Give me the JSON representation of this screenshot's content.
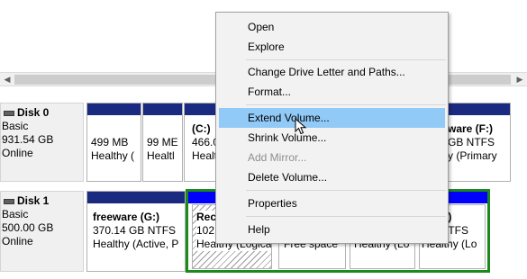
{
  "scrollbar": {
    "left_arrow": "◀",
    "right_arrow": "▶"
  },
  "disks": [
    {
      "name": "Disk 0",
      "type": "Basic",
      "size": "931.54 GB",
      "status": "Online",
      "partitions": [
        {
          "line1": "499 MB",
          "line2": "Healthy ("
        },
        {
          "line1": "99 ME",
          "line2": "Healtl"
        },
        {
          "title": "(C:)",
          "line1": "466.0",
          "line2": "Health"
        },
        {
          "title": "ware  (F:)",
          "line1": "GB NTFS",
          "line2": "y (Primary"
        }
      ]
    },
    {
      "name": "Disk 1",
      "type": "Basic",
      "size": "500.00 GB",
      "status": "Online",
      "partitions": [
        {
          "title": "freeware  (G:)",
          "line1": "370.14 GB NTFS",
          "line2": "Healthy (Active, P"
        },
        {
          "title": "Rec",
          "line1": "102.",
          "line2": "Healthy (Logica"
        },
        {
          "line2": "Free space"
        },
        {
          "line2": "Healthy (Lo"
        },
        {
          "title": "rs  (J:)",
          "line1": "GB NTFS",
          "line2": "Healthy (Lo"
        }
      ]
    }
  ],
  "context_menu": {
    "items": [
      {
        "label": "Open",
        "enabled": true
      },
      {
        "label": "Explore",
        "enabled": true
      },
      {
        "label": "Change Drive Letter and Paths...",
        "enabled": true
      },
      {
        "label": "Format...",
        "enabled": true
      },
      {
        "label": "Extend Volume...",
        "enabled": true,
        "highlighted": true
      },
      {
        "label": "Shrink Volume...",
        "enabled": true
      },
      {
        "label": "Add Mirror...",
        "enabled": false
      },
      {
        "label": "Delete Volume...",
        "enabled": true
      },
      {
        "label": "Properties",
        "enabled": true
      },
      {
        "label": "Help",
        "enabled": true
      }
    ]
  },
  "colors": {
    "volume_bar": "#1a2a80",
    "selection": "#1b8a1b",
    "menu_highlight": "#91c9f7",
    "selected_bar": "#0000ff"
  }
}
